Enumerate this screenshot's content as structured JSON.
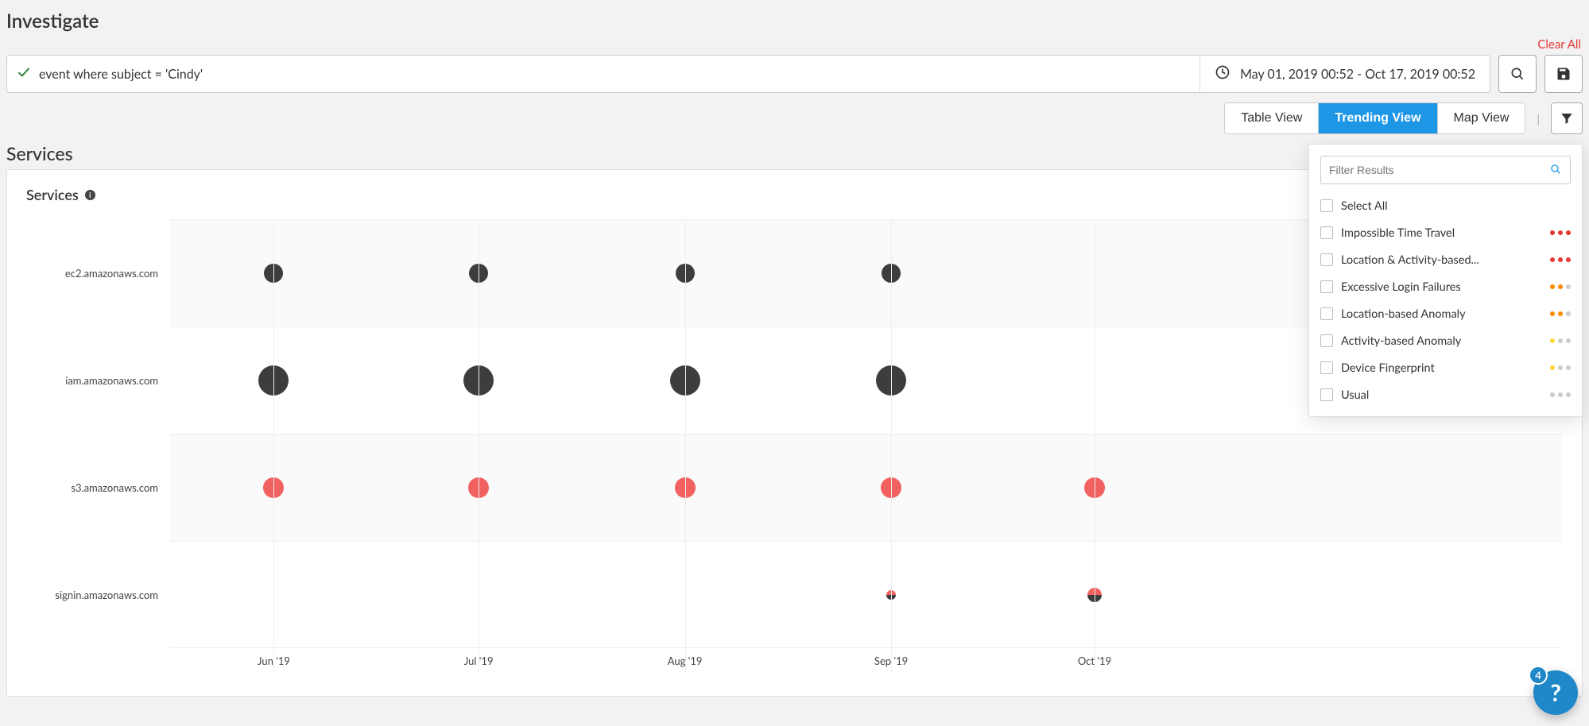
{
  "page_title": "Investigate",
  "clear_all": "Clear All",
  "query": {
    "text": "event where subject = 'Cindy'",
    "date_range": "May 01, 2019 00:52 - Oct 17, 2019 00:52"
  },
  "views": {
    "table": "Table View",
    "trending": "Trending View",
    "map": "Map View",
    "active": "trending"
  },
  "section_title": "Services",
  "panel_title": "Services",
  "filter": {
    "placeholder": "Filter Results",
    "select_all": "Select All",
    "items": [
      {
        "label": "Impossible Time Travel",
        "severity": [
          "red",
          "red",
          "red"
        ]
      },
      {
        "label": "Location & Activity-based...",
        "severity": [
          "red",
          "red",
          "red"
        ]
      },
      {
        "label": "Excessive Login Failures",
        "severity": [
          "orange",
          "orange",
          "gray"
        ]
      },
      {
        "label": "Location-based Anomaly",
        "severity": [
          "orange",
          "orange",
          "gray"
        ]
      },
      {
        "label": "Activity-based Anomaly",
        "severity": [
          "yellow",
          "gray",
          "gray"
        ]
      },
      {
        "label": "Device Fingerprint",
        "severity": [
          "yellow",
          "gray",
          "gray"
        ]
      },
      {
        "label": "Usual",
        "severity": [
          "gray",
          "gray",
          "gray"
        ]
      }
    ]
  },
  "help_badge": "4",
  "chart_data": {
    "type": "scatter",
    "title": "Services",
    "x_categories": [
      "Jun '19",
      "Jul '19",
      "Aug '19",
      "Sep '19",
      "Oct '19"
    ],
    "y_categories": [
      "ec2.amazonaws.com",
      "iam.amazonaws.com",
      "s3.amazonaws.com",
      "signin.amazonaws.com"
    ],
    "series": [
      {
        "name": "ec2.amazonaws.com",
        "points": [
          {
            "x": "Jun '19",
            "size": 24,
            "color": "gray"
          },
          {
            "x": "Jul '19",
            "size": 24,
            "color": "gray"
          },
          {
            "x": "Aug '19",
            "size": 24,
            "color": "gray"
          },
          {
            "x": "Sep '19",
            "size": 24,
            "color": "gray"
          }
        ]
      },
      {
        "name": "iam.amazonaws.com",
        "points": [
          {
            "x": "Jun '19",
            "size": 38,
            "color": "gray"
          },
          {
            "x": "Jul '19",
            "size": 38,
            "color": "gray"
          },
          {
            "x": "Aug '19",
            "size": 38,
            "color": "gray"
          },
          {
            "x": "Sep '19",
            "size": 38,
            "color": "gray"
          }
        ]
      },
      {
        "name": "s3.amazonaws.com",
        "points": [
          {
            "x": "Jun '19",
            "size": 26,
            "color": "red"
          },
          {
            "x": "Jul '19",
            "size": 26,
            "color": "red"
          },
          {
            "x": "Aug '19",
            "size": 26,
            "color": "red"
          },
          {
            "x": "Sep '19",
            "size": 26,
            "color": "red"
          },
          {
            "x": "Oct '19",
            "size": 26,
            "color": "red"
          }
        ]
      },
      {
        "name": "signin.amazonaws.com",
        "points": [
          {
            "x": "Sep '19",
            "size": 12,
            "color": "split"
          },
          {
            "x": "Oct '19",
            "size": 18,
            "color": "split"
          }
        ]
      }
    ],
    "x_positions_pct": {
      "Jun '19": 7.5,
      "Jul '19": 22.2,
      "Aug '19": 37.0,
      "Sep '19": 51.8,
      "Oct '19": 66.4
    }
  }
}
